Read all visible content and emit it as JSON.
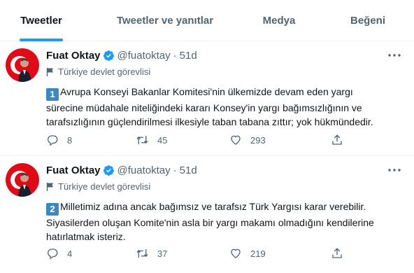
{
  "tabs": [
    {
      "label": "Tweetler",
      "active": true
    },
    {
      "label": "Tweetler ve yanıtlar",
      "active": false
    },
    {
      "label": "Medya",
      "active": false
    },
    {
      "label": "Beğeni",
      "active": false
    }
  ],
  "colors": {
    "accent": "#1d9bf0",
    "text": "#0f1419",
    "muted": "#536471",
    "number_badge": "#3b88c3",
    "avatar_bg": "#e30a17"
  },
  "tweets": [
    {
      "name": "Fuat Oktay",
      "handle": "@fuatoktay",
      "dot": "·",
      "time": "51d",
      "label": "Türkiye devlet görevlisi",
      "number": "1",
      "lines": [
        "Avrupa Konseyi Bakanlar Komitesi'nin ülkemizde devam eden yargı",
        "sürecine müdahale niteliğindeki kararı Konsey'in yargı bağımsızlığının ve",
        "tarafsızlığının güçlendirilmesi ilkesiyle taban tabana zıttır; yok hükmündedir."
      ],
      "replies": "8",
      "retweets": "45",
      "likes": "293"
    },
    {
      "name": "Fuat Oktay",
      "handle": "@fuatoktay",
      "dot": "·",
      "time": "51d",
      "label": "Türkiye devlet görevlisi",
      "number": "2",
      "lines": [
        "Milletimiz adına ancak bağımsız ve tarafsız Türk Yargısı karar verebilir.",
        "Siyasilerden oluşan Komite'nin asla bir yargı makamı olmadığını kendilerine",
        "hatırlatmak isteriz."
      ],
      "replies": "4",
      "retweets": "37",
      "likes": "219"
    }
  ]
}
